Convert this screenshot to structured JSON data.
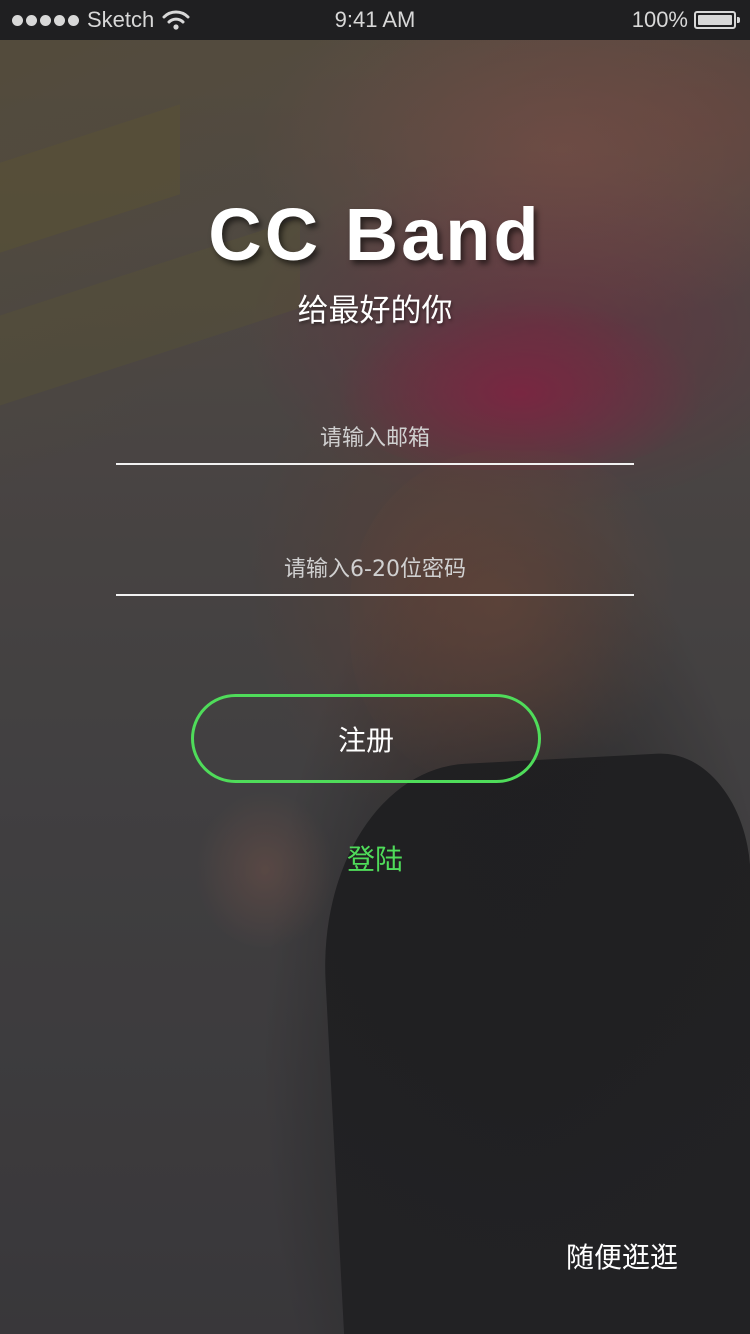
{
  "status_bar": {
    "carrier": "Sketch",
    "time": "9:41 AM",
    "battery": "100%"
  },
  "app": {
    "title": "CC Band",
    "subtitle": "给最好的你"
  },
  "form": {
    "email_placeholder": "请输入邮箱",
    "password_placeholder": "请输入6-20位密码",
    "register_label": "注册",
    "login_label": "登陆",
    "browse_label": "随便逛逛"
  },
  "colors": {
    "accent": "#4fdc5a",
    "text": "#ffffff",
    "status_bar_bg": "#1f1f21"
  }
}
